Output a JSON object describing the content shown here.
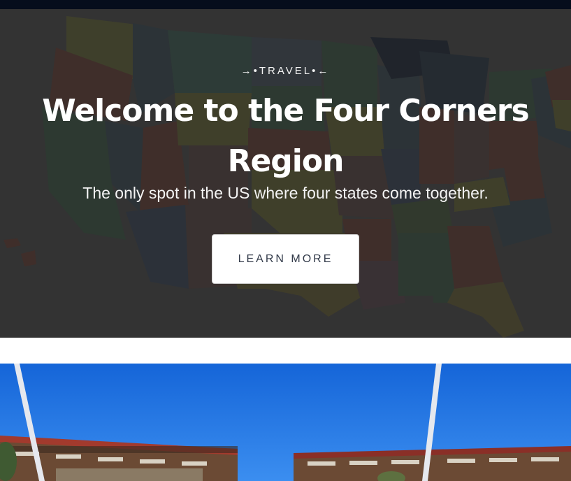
{
  "hero": {
    "eyebrow": "→•TRAVEL•←",
    "headline": "Welcome to the Four Corners Region",
    "subhead": "The only spot in the US where four states come together.",
    "cta_label": "LEARN MORE"
  },
  "colors": {
    "top_bar": "#060d1c",
    "hero_overlay": "#3d3d3d",
    "cta_bg": "#ffffff",
    "cta_text": "#333b4a",
    "sky": "#1f6fe0"
  },
  "icons": {
    "map": "us-states-map-image",
    "photo": "four-corners-monument-photo"
  }
}
